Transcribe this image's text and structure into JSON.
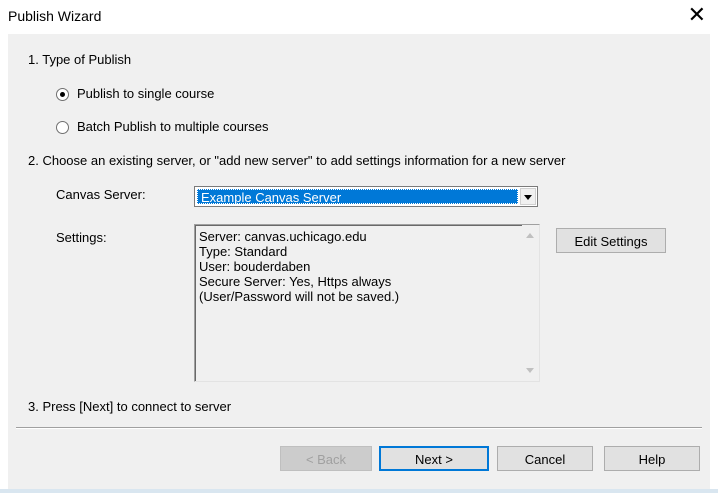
{
  "window": {
    "title": "Publish Wizard",
    "close_glyph": "✕"
  },
  "step1": {
    "label": "1. Type of Publish",
    "options": [
      {
        "label": "Publish to single course",
        "checked": true
      },
      {
        "label": "Batch Publish to multiple courses",
        "checked": false
      }
    ]
  },
  "step2": {
    "label": "2. Choose an existing server, or \"add new server\" to add settings information for a new server",
    "server_label": "Canvas Server:",
    "server_value": "Example Canvas Server",
    "settings_label": "Settings:",
    "settings_text": "Server: canvas.uchicago.edu\nType: Standard\nUser: bouderdaben\nSecure Server: Yes, Https always\n(User/Password will not be saved.)",
    "edit_button": "Edit Settings"
  },
  "step3": {
    "label": "3. Press [Next] to connect to server"
  },
  "buttons": {
    "back": "< Back",
    "next": "Next >",
    "cancel": "Cancel",
    "help": "Help"
  }
}
